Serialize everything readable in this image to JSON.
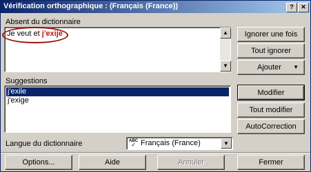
{
  "window": {
    "title": "Vérification orthographique : (Français (France))"
  },
  "absent": {
    "label": "Absent du dictionnaire",
    "sentence_before": "Je veut et ",
    "error_word": "j'exije"
  },
  "suggestions": {
    "label": "Suggestions",
    "items": [
      "j'exile",
      "j'exige"
    ],
    "selected_index": 0
  },
  "language": {
    "label": "Langue du dictionnaire",
    "value": "Français (France)"
  },
  "buttons": {
    "ignore_once": "Ignorer une fois",
    "ignore_all": "Tout ignorer",
    "add": "Ajouter",
    "change": "Modifier",
    "change_all": "Tout modifier",
    "autocorrect": "AutoCorrection",
    "options": "Options...",
    "help": "Aide",
    "cancel": "Annuler",
    "close": "Fermer"
  },
  "icons": {
    "add_dropdown": "triangle-down-icon",
    "close": "close-icon",
    "help": "help-icon",
    "lang": "spellcheck-abc-icon"
  },
  "colors": {
    "title_start": "#0a246a",
    "error_text": "#c0140c",
    "selection": "#0a246a"
  }
}
